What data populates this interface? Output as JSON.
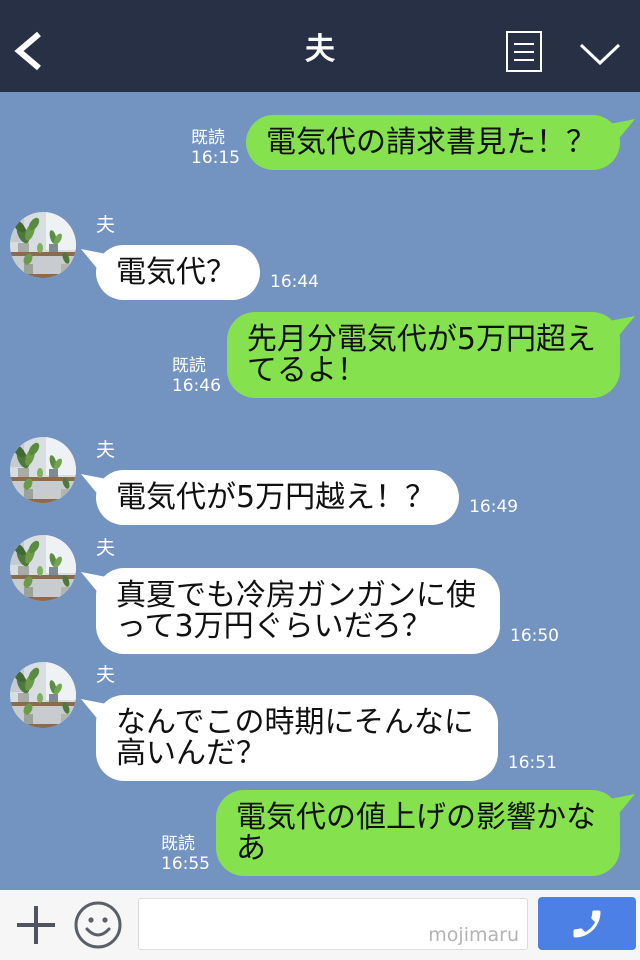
{
  "header": {
    "title": "夫",
    "icons": {
      "back": "chevron-left-icon",
      "notes": "note-list-icon",
      "menu": "chevron-down-icon"
    }
  },
  "chat": {
    "messages": [
      {
        "text": "電気代の請求書見た！？",
        "read": "既読",
        "time": "16:15"
      },
      {
        "name": "夫",
        "text": "電気代？",
        "time": "16:44"
      },
      {
        "text": "先月分電気代が5万円超え\nてるよ！",
        "read": "既読",
        "time": "16:46"
      },
      {
        "name": "夫",
        "text": "電気代が5万円越え！？",
        "time": "16:49"
      },
      {
        "name": "夫",
        "text": "真夏でも冷房ガンガンに使\nって3万円ぐらいだろ？",
        "time": "16:50"
      },
      {
        "name": "夫",
        "text": "なんでこの時期にそんなに\n高いんだ？",
        "time": "16:51"
      },
      {
        "text": "電気代の値上げの影響かな\nあ",
        "read": "既読",
        "time": "16:55"
      }
    ]
  },
  "composer": {
    "input_value": "",
    "watermark": "mojimaru",
    "icons": {
      "add": "plus-icon",
      "emoji": "smiley-icon",
      "call": "phone-icon"
    }
  },
  "colors": {
    "header_bg": "#283045",
    "chat_bg": "#7393c1",
    "sent_bubble": "#85e14e",
    "received_bubble": "#ffffff",
    "call_button": "#4c80e5"
  }
}
